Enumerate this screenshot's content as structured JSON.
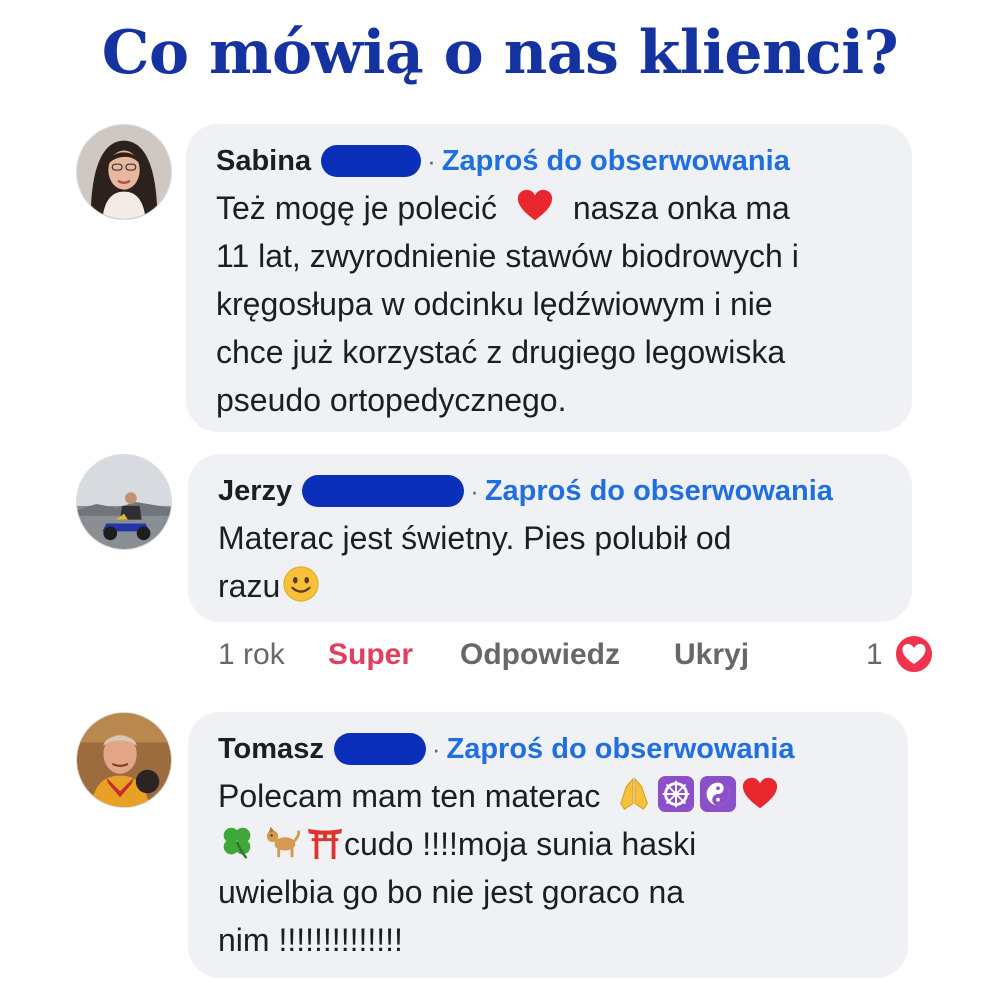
{
  "headline": "Co mówią o nas klienci?",
  "colors": {
    "headline": "#1432a0",
    "link": "#1f6fe0",
    "bubble_bg": "#f0f1f4",
    "redaction": "#0a2fb8",
    "reaction_like": "#e0405e"
  },
  "separator": "·",
  "comments": [
    {
      "name": "Sabina",
      "follow_label": "Zaproś do obserwowania",
      "text_lines": [
        "Też mogę je polecić",
        "nasza onka ma",
        "11 lat, zwyrodnienie stawów biodrowych i",
        "kręgosłupa w odcinku lędźwiowym i nie",
        "chce już korzystać z drugiego legowiska",
        "pseudo ortopedycznego."
      ],
      "emojis": [
        "red-heart-icon"
      ]
    },
    {
      "name": "Jerzy",
      "follow_label": "Zaproś do obserwowania",
      "text_lines": [
        "Materac jest świetny. Pies polubił od",
        "razu"
      ],
      "emojis": [
        "smiling-face-icon"
      ]
    },
    {
      "name": "Tomasz",
      "follow_label": "Zaproś do obserwowania",
      "text_lines": [
        "Polecam mam ten materac",
        "cudo !!!!moja sunia haski",
        "uwielbia go bo nie jest goraco na",
        "nim !!!!!!!!!!!!!!"
      ],
      "emojis": [
        "folded-hands-icon",
        "wheel-of-dharma-icon",
        "yin-yang-icon",
        "red-heart-icon",
        "four-leaf-clover-icon",
        "dog-icon",
        "torii-gate-icon"
      ]
    }
  ],
  "actions": {
    "time": "1 rok",
    "like": "Super",
    "reply": "Odpowiedz",
    "hide": "Ukryj",
    "reaction_count": "1",
    "reaction_icon": "heart-reaction-icon"
  }
}
